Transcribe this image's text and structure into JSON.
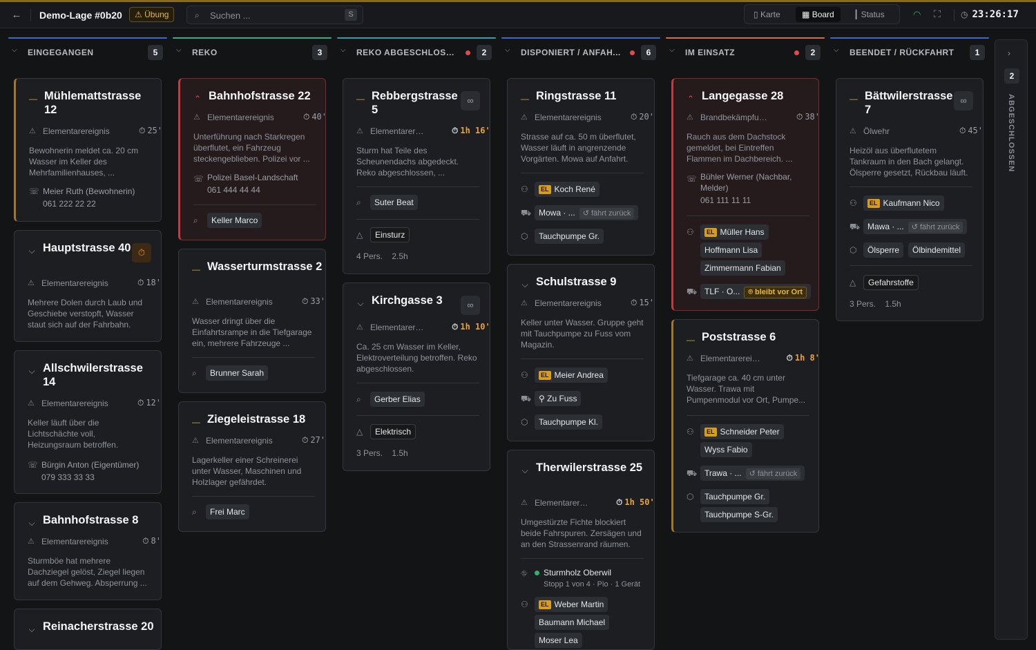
{
  "header": {
    "back_icon": "arrow-left-icon",
    "title": "Demo-Lage #0b20",
    "exercise_badge": "Übung",
    "search_placeholder": "Suchen ...",
    "search_shortcut": "S",
    "views": [
      {
        "label": "Karte",
        "icon": "map-icon"
      },
      {
        "label": "Board",
        "icon": "grid-icon",
        "active": true
      },
      {
        "label": "Status",
        "icon": "bar-chart-icon"
      }
    ],
    "clock": "23:26:17"
  },
  "columns": [
    {
      "name": "EINGEGANGEN",
      "count": "5",
      "color": "#3b6bd1"
    },
    {
      "name": "REKO",
      "count": "3",
      "color": "#2fb38a"
    },
    {
      "name": "REKO ABGESCHLOSS...",
      "count": "2",
      "color": "#2fa3b3"
    },
    {
      "name": "DISPONIERT / ANFAH...",
      "count": "6",
      "color": "#3b6bd1"
    },
    {
      "name": "IM EINSATZ",
      "count": "2",
      "color": "#e0694a"
    },
    {
      "name": "BEENDET / RÜCKFAHRT",
      "count": "1",
      "color": "#3b6bd1"
    }
  ],
  "closed": {
    "count": "2",
    "label": "ABGESCHLOSSEN"
  },
  "cards": {
    "c1": {
      "title": "Mühlemattstrasse 12",
      "type": "Elementarereignis",
      "dur": "25'",
      "desc": "Bewohnerin meldet ca. 20 cm Wasser im Keller des Mehrfamilienhauses, ...",
      "contact": "Meier Ruth (Bewohnerin)",
      "phone": "061 222 22 22"
    },
    "c2": {
      "title": "Hauptstrasse 40",
      "type": "Elementarereignis",
      "dur": "18'",
      "desc": "Mehrere Dolen durch Laub und Geschiebe verstopft, Wasser staut sich auf der Fahrbahn."
    },
    "c3": {
      "title": "Allschwilerstrasse 14",
      "type": "Elementarereignis",
      "dur": "12'",
      "desc": "Keller läuft über die Lichtschächte voll, Heizungsraum betroffen.",
      "contact": "Bürgin Anton (Eigentümer)",
      "phone": "079 333 33 33"
    },
    "c4": {
      "title": "Bahnhofstrasse 8",
      "type": "Elementarereignis",
      "dur": "8'",
      "desc": "Sturmböe hat mehrere Dachziegel gelöst, Ziegel liegen auf dem Gehweg. Absperrung ..."
    },
    "c5": {
      "title": "Reinacherstrasse 20"
    },
    "c6": {
      "title": "Bahnhofstrasse 22",
      "type": "Elementarereignis",
      "dur": "40'",
      "desc": "Unterführung nach Starkregen überflutet, ein Fahrzeug steckengeblieben. Polizei vor ...",
      "contact": "Polizei Basel-Landschaft",
      "phone": "061 444 44 44",
      "reko": "Keller Marco"
    },
    "c7": {
      "title": "Wasserturmstrasse 2",
      "type": "Elementarereignis",
      "dur": "33'",
      "desc": "Wasser dringt über die Einfahrtsrampe in die Tiefgarage ein, mehrere Fahrzeuge ...",
      "reko": "Brunner Sarah"
    },
    "c8": {
      "title": "Ziegeleistrasse 18",
      "type": "Elementarereignis",
      "dur": "27'",
      "desc": "Lagerkeller einer Schreinerei unter Wasser, Maschinen und Holzlager gefährdet.",
      "reko": "Frei Marc"
    },
    "c9": {
      "title": "Rebbergstrasse 5",
      "type": "Elementarerei...",
      "dur": "1h 16'",
      "desc": "Sturm hat Teile des Scheunendachs abgedeckt. Reko abgeschlossen, ...",
      "reko": "Suter Beat",
      "hazard": "Einsturz",
      "pers": "4 Pers.",
      "time": "2.5h"
    },
    "c10": {
      "title": "Kirchgasse 3",
      "type": "Elementarerei...",
      "dur": "1h 10'",
      "desc": "Ca. 25 cm Wasser im Keller, Elektroverteilung betroffen. Reko abgeschlossen.",
      "reko": "Gerber Elias",
      "hazard": "Elektrisch",
      "pers": "3 Pers.",
      "time": "1.5h"
    },
    "c11": {
      "title": "Ringstrasse 11",
      "type": "Elementarereignis",
      "dur": "20'",
      "desc": "Strasse auf ca. 50 m überflutet, Wasser läuft in angrenzende Vorgärten. Mowa auf Anfahrt.",
      "el": "EL",
      "leader": "Koch René",
      "vehicle": "Mowa · ...",
      "vstatus": "fährt zurück",
      "equip": "Tauchpumpe Gr."
    },
    "c12": {
      "title": "Schulstrasse 9",
      "type": "Elementarereignis",
      "dur": "15'",
      "desc": "Keller unter Wasser. Gruppe geht mit Tauchpumpe zu Fuss vom Magazin.",
      "el": "EL",
      "leader": "Meier Andrea",
      "vehicle": "Zu Fuss",
      "equip": "Tauchpumpe Kl."
    },
    "c13": {
      "title": "Therwilerstrasse 25",
      "type": "Elementarerei...",
      "dur": "1h 50'",
      "desc": "Umgestürzte Fichte blockiert beide Fahrspuren. Zersägen und an den Strassenrand räumen.",
      "route": "Sturmholz Oberwil",
      "route_sub": "Stopp 1 von 4 · Pio · 1 Gerät",
      "el": "EL",
      "leader": "Weber Martin",
      "crew": [
        "Baumann Michael",
        "Moser Lea"
      ]
    },
    "c14": {
      "title": "Langegasse 28",
      "type": "Brandbekämpfung",
      "dur": "38'",
      "desc": "Rauch aus dem Dachstock gemeldet, bei Eintreffen Flammen im Dachbereich. ...",
      "contact": "Bühler Werner (Nachbar, Melder)",
      "phone": "061 111 11 11",
      "el": "EL",
      "leader": "Müller Hans",
      "crew": [
        "Hoffmann Lisa",
        "Zimmermann Fabian"
      ],
      "vehicle": "TLF · O...",
      "vstatus": "bleibt vor Ort"
    },
    "c15": {
      "title": "Poststrasse 6",
      "type": "Elementarereig...",
      "dur": "1h 8'",
      "desc": "Tiefgarage ca. 40 cm unter Wasser. Trawa mit Pumpenmodul vor Ort, Pumpe...",
      "el": "EL",
      "leader": "Schneider Peter",
      "crew": [
        "Wyss Fabio"
      ],
      "vehicle": "Trawa · ...",
      "vstatus": "fährt zurück",
      "equip": [
        "Tauchpumpe Gr.",
        "Tauchpumpe S-Gr."
      ]
    },
    "c16": {
      "title": "Bättwilerstrasse 7",
      "type": "Ölwehr",
      "dur": "45'",
      "desc": "Heizöl aus überflutetem Tankraum in den Bach gelangt. Ölsperre gesetzt, Rückbau läuft.",
      "el": "EL",
      "leader": "Kaufmann Nico",
      "vehicle": "Mawa · ...",
      "vstatus": "fährt zurück",
      "equip": [
        "Ölsperre",
        "Ölbindemittel"
      ],
      "hazard": "Gefahrstoffe",
      "pers": "3 Pers.",
      "time": "1.5h"
    }
  }
}
